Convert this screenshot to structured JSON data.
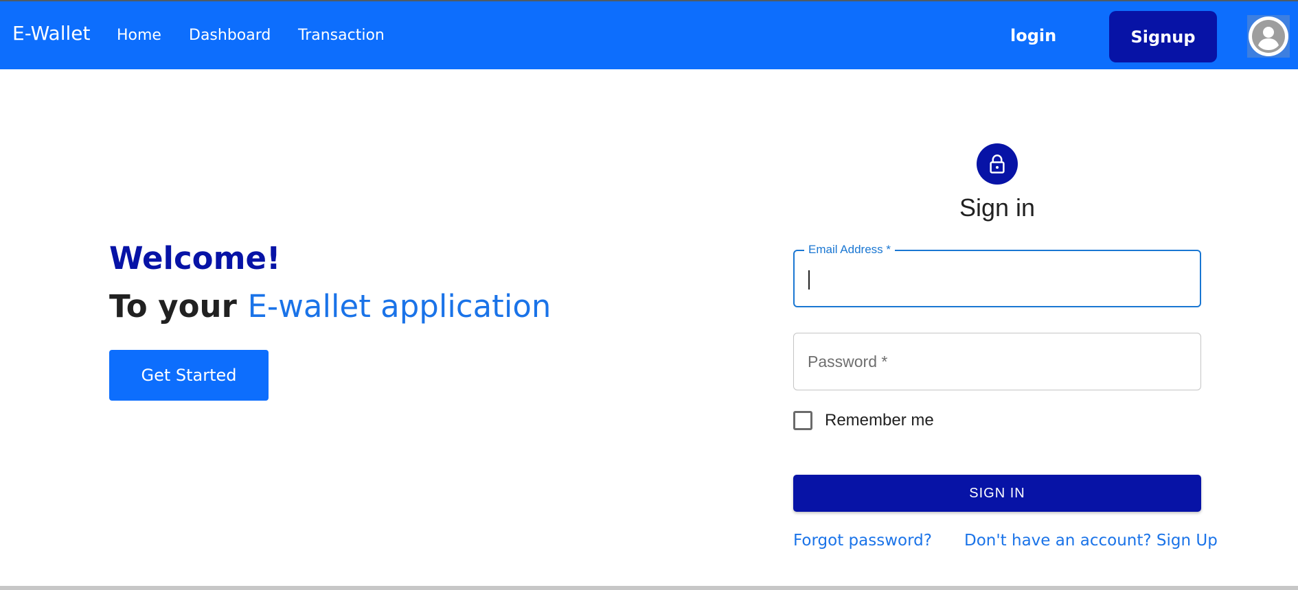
{
  "navbar": {
    "brand": "E-Wallet",
    "links": [
      "Home",
      "Dashboard",
      "Transaction"
    ],
    "login_label": "login",
    "signup_label": "Signup",
    "avatar_icon": "account-circle-icon"
  },
  "hero": {
    "welcome": "Welcome!",
    "tagline_prefix": "To your ",
    "tagline_accent": "E-wallet application",
    "cta_label": "Get Started"
  },
  "signin": {
    "icon": "lock-icon",
    "title": "Sign in",
    "email_label": "Email Address *",
    "email_value": "",
    "password_placeholder": "Password *",
    "remember_label": "Remember me",
    "remember_checked": false,
    "submit_label": "SIGN IN",
    "forgot_label": "Forgot password?",
    "signup_prompt": "Don't have an account? Sign Up"
  },
  "colors": {
    "navbar": "#0d6efd",
    "primary_dark": "#0713a6",
    "link": "#1a73e8",
    "focus": "#1976d2"
  }
}
